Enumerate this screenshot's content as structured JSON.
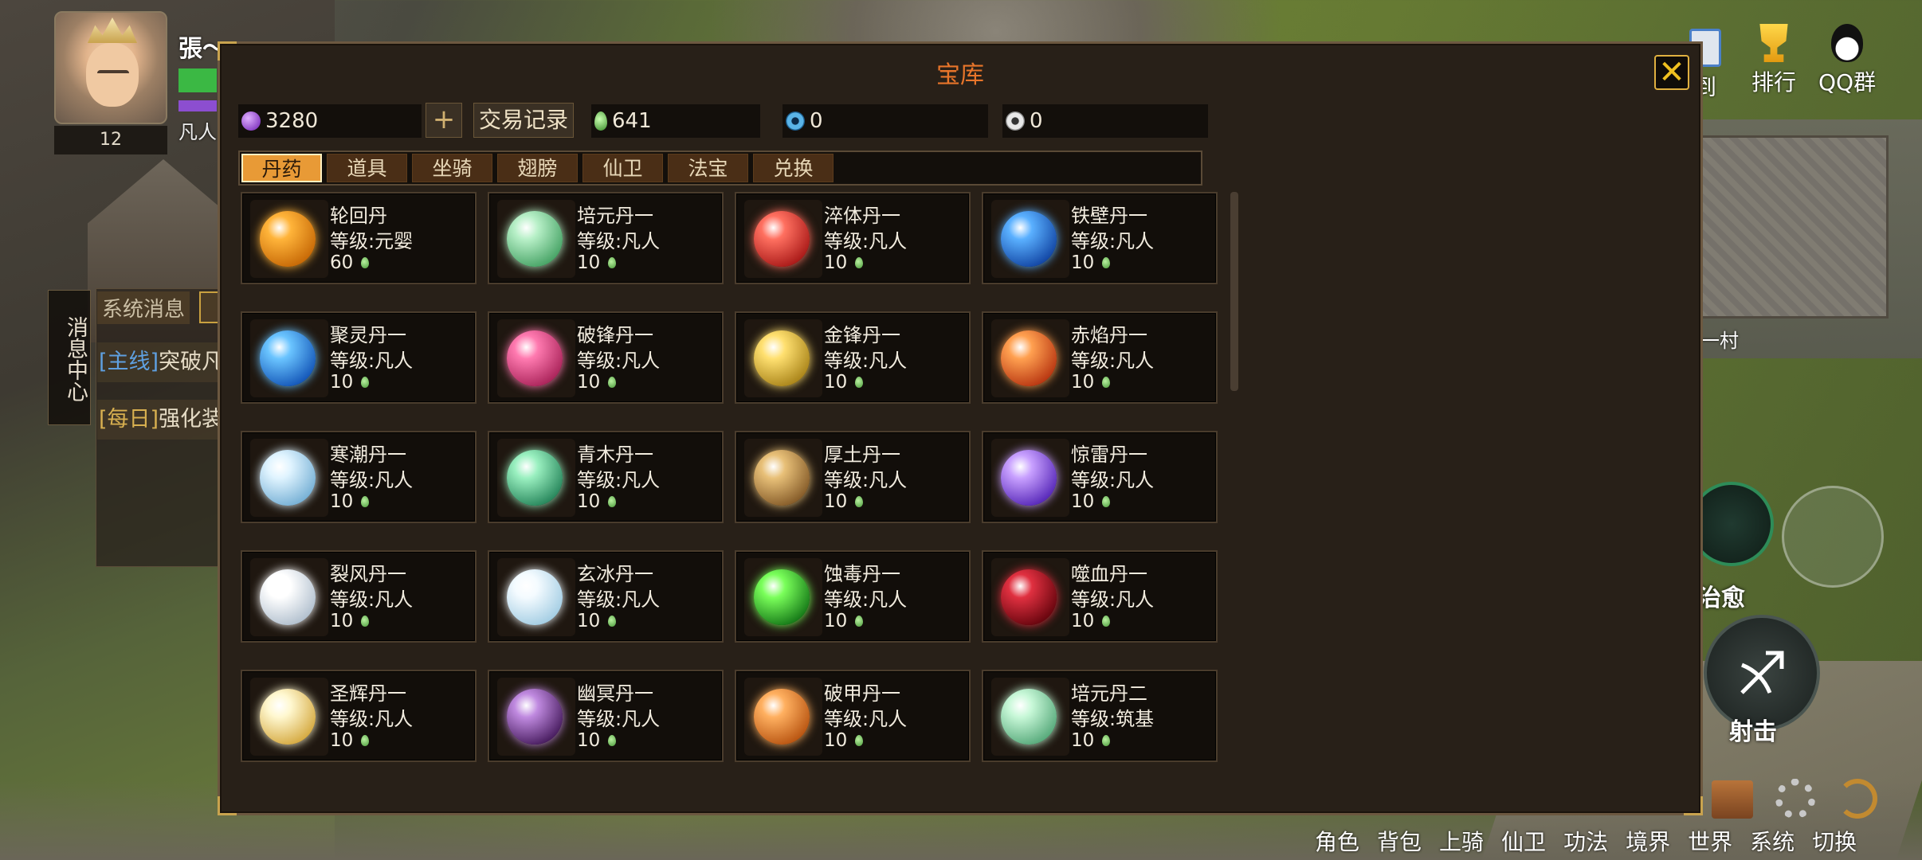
{
  "hud": {
    "player_name": "張〜",
    "player_level": "12",
    "realm": "凡人",
    "message_center": "消息中心",
    "chat_tab": "系统消息",
    "quests": [
      {
        "tag": "[主线]",
        "text": "突破凡"
      },
      {
        "tag": "[每日]",
        "text": "强化装"
      }
    ],
    "top_icons": [
      {
        "label": "到",
        "icon": "checkin-icon"
      },
      {
        "label": "排行",
        "icon": "trophy-icon"
      },
      {
        "label": "QQ群",
        "icon": "qq-icon"
      }
    ],
    "minimap_label": "一村",
    "skill_heal": "治愈",
    "skill_shoot": "射击",
    "bottom_menu": [
      "角色",
      "背包",
      "上骑",
      "仙卫",
      "功法",
      "境界",
      "世界",
      "系统",
      "切换"
    ]
  },
  "panel": {
    "title": "宝库",
    "close_symbol": "✕",
    "currencies": [
      {
        "icon": "purple-gem-icon",
        "color": "#9a4cd8",
        "value": "3280"
      },
      {
        "icon": "green-leaf-icon",
        "color": "#6fc25a",
        "value": "641"
      },
      {
        "icon": "blue-orb-icon",
        "color": "#5ab4e8",
        "value": "0"
      },
      {
        "icon": "silver-coin-icon",
        "color": "#c8c8c8",
        "value": "0"
      }
    ],
    "plus_label": "+",
    "trade_label": "交易记录",
    "tabs": [
      "丹药",
      "道具",
      "坐骑",
      "翅膀",
      "仙卫",
      "法宝",
      "兑换"
    ],
    "active_tab": "丹药",
    "items": [
      {
        "name": "轮回丹",
        "level": "等级:元婴",
        "price": "60",
        "color1": "#ffb43a",
        "color2": "#c06000"
      },
      {
        "name": "培元丹一",
        "level": "等级:凡人",
        "price": "10",
        "color1": "#b8f0c8",
        "color2": "#3a9a5a"
      },
      {
        "name": "淬体丹一",
        "level": "等级:凡人",
        "price": "10",
        "color1": "#ff7060",
        "color2": "#a01010"
      },
      {
        "name": "铁壁丹一",
        "level": "等级:凡人",
        "price": "10",
        "color1": "#5ab0ff",
        "color2": "#0a3a9a"
      },
      {
        "name": "聚灵丹一",
        "level": "等级:凡人",
        "price": "10",
        "color1": "#6ac4ff",
        "color2": "#0a4ab0"
      },
      {
        "name": "破锋丹一",
        "level": "等级:凡人",
        "price": "10",
        "color1": "#ff7ab0",
        "color2": "#a01a50"
      },
      {
        "name": "金锋丹一",
        "level": "等级:凡人",
        "price": "10",
        "color1": "#ffe070",
        "color2": "#a07a10"
      },
      {
        "name": "赤焰丹一",
        "level": "等级:凡人",
        "price": "10",
        "color1": "#ffa050",
        "color2": "#b02a0a"
      },
      {
        "name": "寒潮丹一",
        "level": "等级:凡人",
        "price": "10",
        "color1": "#e0f4ff",
        "color2": "#6aa8d0"
      },
      {
        "name": "青木丹一",
        "level": "等级:凡人",
        "price": "10",
        "color1": "#9af0c0",
        "color2": "#1a7a50"
      },
      {
        "name": "厚土丹一",
        "level": "等级:凡人",
        "price": "10",
        "color1": "#e8c078",
        "color2": "#7a5020"
      },
      {
        "name": "惊雷丹一",
        "level": "等级:凡人",
        "price": "10",
        "color1": "#c8a0ff",
        "color2": "#4a1ab0"
      },
      {
        "name": "裂风丹一",
        "level": "等级:凡人",
        "price": "10",
        "color1": "#ffffff",
        "color2": "#a8b8c8"
      },
      {
        "name": "玄冰丹一",
        "level": "等级:凡人",
        "price": "10",
        "color1": "#f4fbff",
        "color2": "#9ac8e0"
      },
      {
        "name": "蚀毒丹一",
        "level": "等级:凡人",
        "price": "10",
        "color1": "#7aff5a",
        "color2": "#0a6a10"
      },
      {
        "name": "噬血丹一",
        "level": "等级:凡人",
        "price": "10",
        "color1": "#e03040",
        "color2": "#5a0008"
      },
      {
        "name": "圣辉丹一",
        "level": "等级:凡人",
        "price": "10",
        "color1": "#fff8d0",
        "color2": "#d0a030"
      },
      {
        "name": "幽冥丹一",
        "level": "等级:凡人",
        "price": "10",
        "color1": "#c08ae0",
        "color2": "#3a1050"
      },
      {
        "name": "破甲丹一",
        "level": "等级:凡人",
        "price": "10",
        "color1": "#ffb060",
        "color2": "#b04a08"
      },
      {
        "name": "培元丹二",
        "level": "等级:筑基",
        "price": "10",
        "color1": "#c8f8d8",
        "color2": "#4aa070"
      }
    ]
  }
}
